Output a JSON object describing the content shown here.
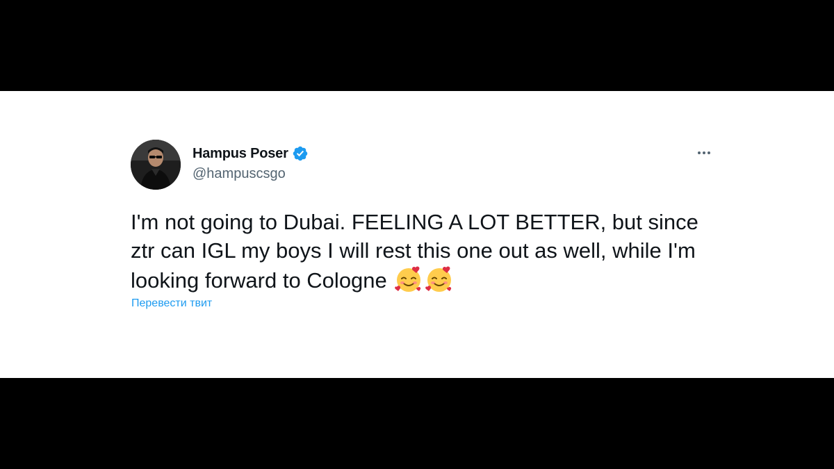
{
  "tweet": {
    "author": {
      "display_name": "Hampus Poser",
      "handle": "@hampuscsgo",
      "verified": true,
      "avatar_icon": "profile-photo"
    },
    "more_icon": "ellipsis-icon",
    "text": "I'm not going to Dubai. FEELING A LOT BETTER, but since ztr can IGL my boys I will rest this one out as well, while I'm looking forward to Cologne",
    "emojis": [
      "smiling-face-with-hearts",
      "smiling-face-with-hearts"
    ],
    "translate_label": "Перевести твит"
  },
  "colors": {
    "background": "#000000",
    "card": "#ffffff",
    "text_primary": "#0f1419",
    "text_secondary": "#536471",
    "accent": "#1d9bf0"
  }
}
